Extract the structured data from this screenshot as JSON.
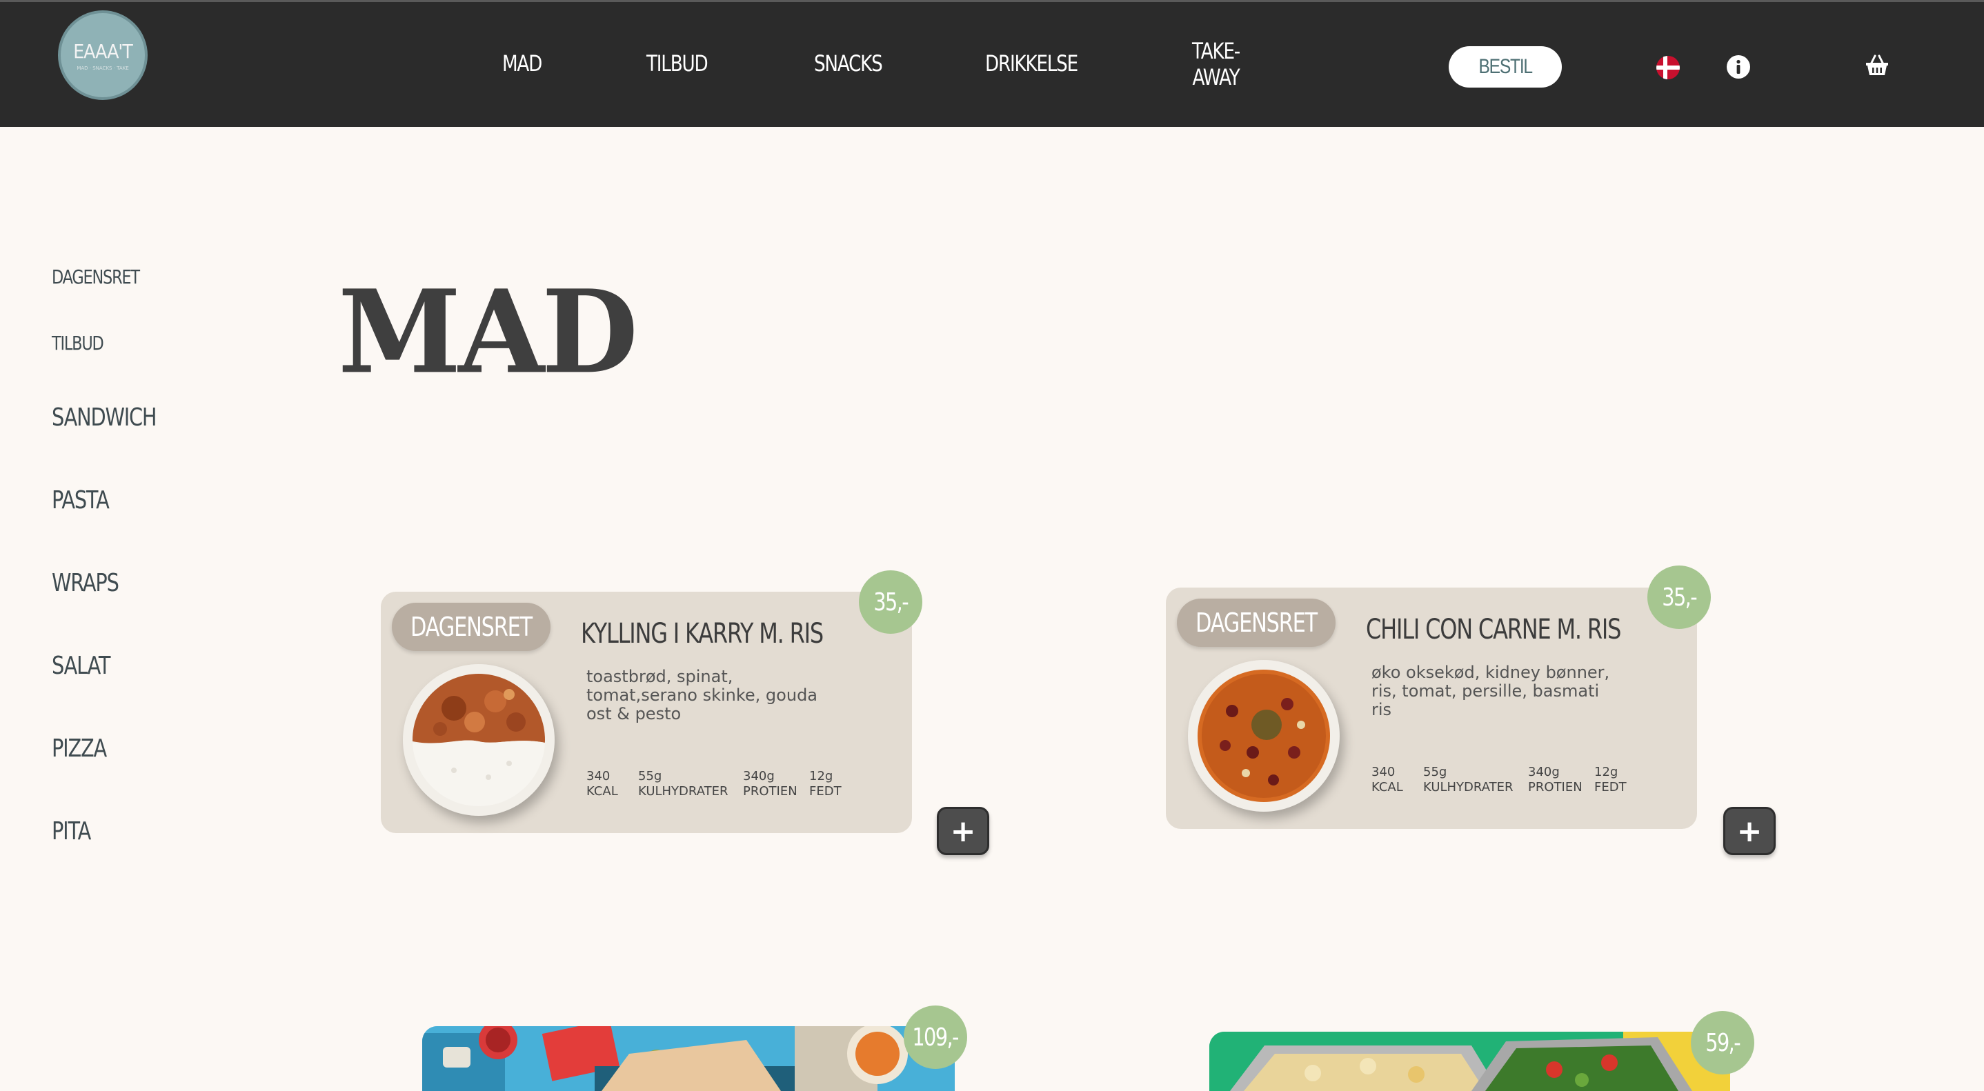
{
  "brand": {
    "logo_text": "EAAA'T",
    "logo_subtext": "MAD · SNACKS · TAKE"
  },
  "nav": {
    "items": [
      "MAD",
      "TILBUD",
      "SNACKS",
      "DRIKKELSE"
    ],
    "takeaway_line1": "TAKE-",
    "takeaway_line2": "AWAY",
    "order_button": "BESTIL"
  },
  "sidebar": {
    "items": [
      "DAGENSRET",
      "TILBUD",
      "SANDWICH",
      "PASTA",
      "WRAPS",
      "SALAT",
      "PIZZA",
      "PITA"
    ]
  },
  "page": {
    "title": "MAD"
  },
  "cards": [
    {
      "tag": "DAGENSRET",
      "name": "KYLLING I KARRY M. RIS",
      "description": "toastbrød, spinat, tomat,serano skinke, gouda ost & pesto",
      "price": "35,-",
      "nutrition": [
        {
          "value": "340",
          "label": "KCAL"
        },
        {
          "value": "55g",
          "label": "KULHYDRATER"
        },
        {
          "value": "340g",
          "label": "PROTIEN"
        },
        {
          "value": "12g",
          "label": "FEDT"
        }
      ],
      "add": "+"
    },
    {
      "tag": "DAGENSRET",
      "name": "CHILI CON CARNE M. RIS",
      "description": "øko oksekød, kidney bønner, ris, tomat, persille, basmati ris",
      "price": "35,-",
      "nutrition": [
        {
          "value": "340",
          "label": "KCAL"
        },
        {
          "value": "55g",
          "label": "KULHYDRATER"
        },
        {
          "value": "340g",
          "label": "PROTIEN"
        },
        {
          "value": "12g",
          "label": "FEDT"
        }
      ],
      "add": "+"
    }
  ],
  "preview_prices": [
    "109,-",
    "59,-"
  ],
  "colors": {
    "header": "#2b2b2b",
    "background": "#fcf8f4",
    "card": "#e3dcd2",
    "price_badge": "#a6c690",
    "tag": "#b9aea2"
  },
  "icons": [
    "danish-flag-icon",
    "info-icon",
    "basket-icon",
    "plus-icon"
  ]
}
